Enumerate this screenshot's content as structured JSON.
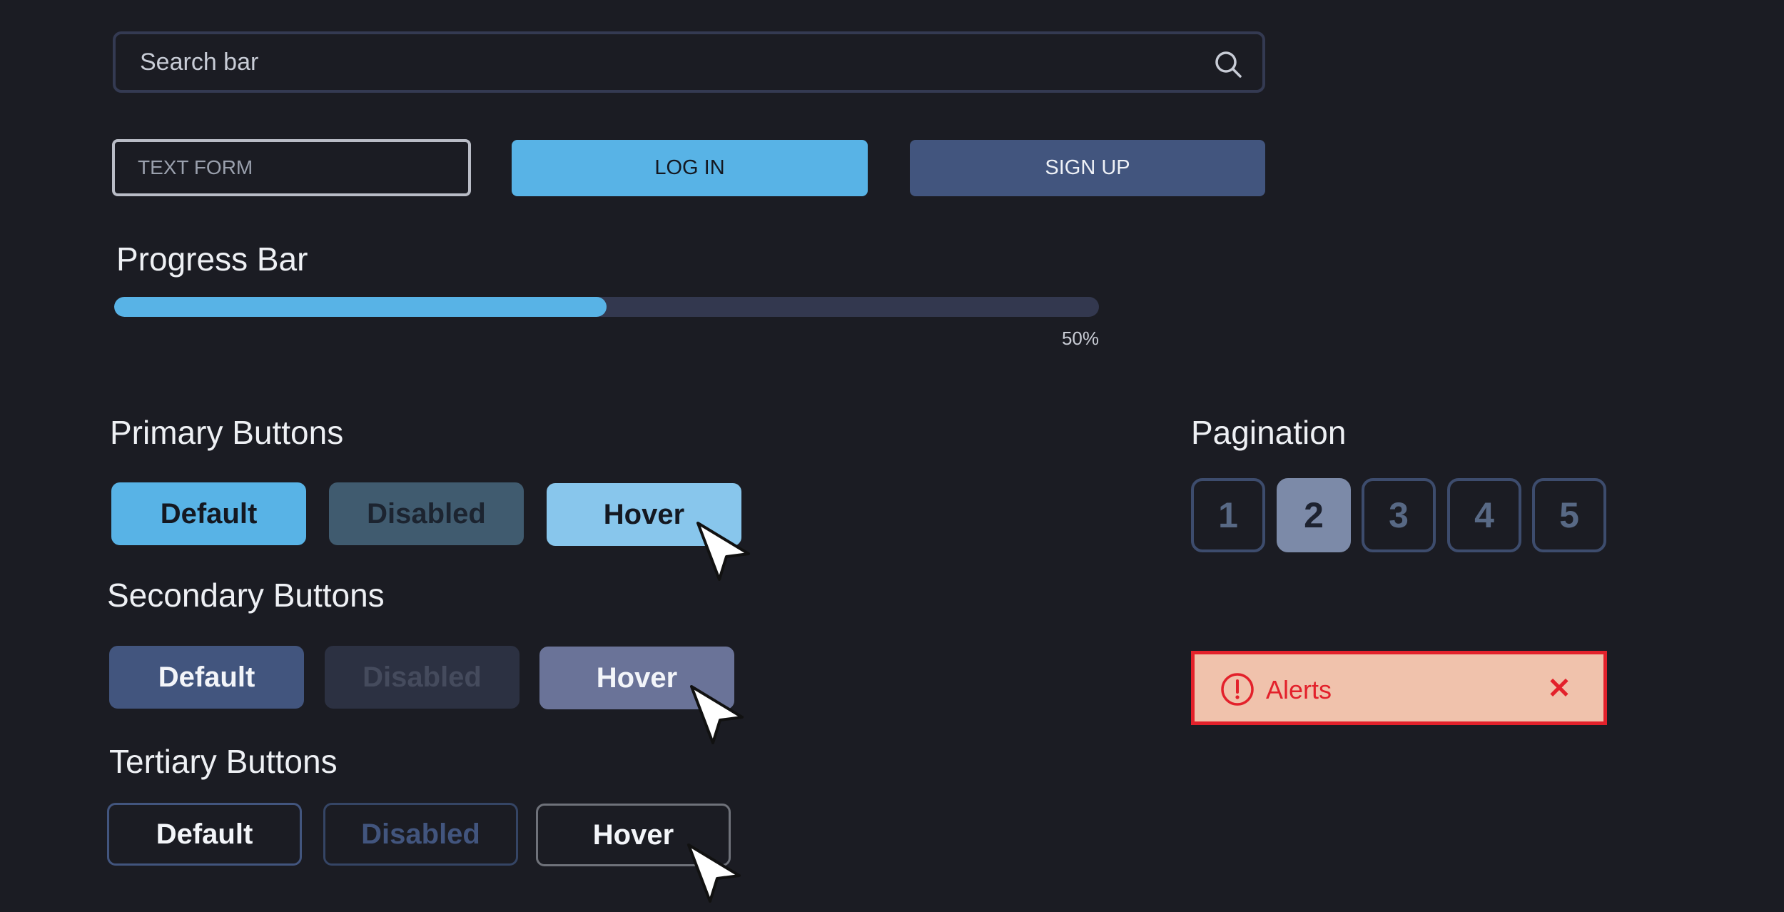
{
  "search": {
    "placeholder": "Search bar",
    "icon": "search-icon"
  },
  "form": {
    "text_placeholder": "TEXT FORM",
    "login_label": "LOG IN",
    "signup_label": "SIGN UP"
  },
  "progress": {
    "title": "Progress Bar",
    "value": 50,
    "value_label": "50%"
  },
  "primary": {
    "title": "Primary Buttons",
    "default_label": "Default",
    "disabled_label": "Disabled",
    "hover_label": "Hover"
  },
  "secondary": {
    "title": "Secondary Buttons",
    "default_label": "Default",
    "disabled_label": "Disabled",
    "hover_label": "Hover"
  },
  "tertiary": {
    "title": "Tertiary Buttons",
    "default_label": "Default",
    "disabled_label": "Disabled",
    "hover_label": "Hover"
  },
  "pagination": {
    "title": "Pagination",
    "pages": [
      "1",
      "2",
      "3",
      "4",
      "5"
    ],
    "active_page": "2"
  },
  "alert": {
    "text": "Alerts",
    "icon": "exclamation-circle-icon",
    "close_icon": "close-icon"
  },
  "colors": {
    "background": "#1b1c23",
    "accent": "#58b3e6",
    "secondary": "#42557e",
    "alert": "#e3212b",
    "alert_background": "#f0c2ac"
  }
}
